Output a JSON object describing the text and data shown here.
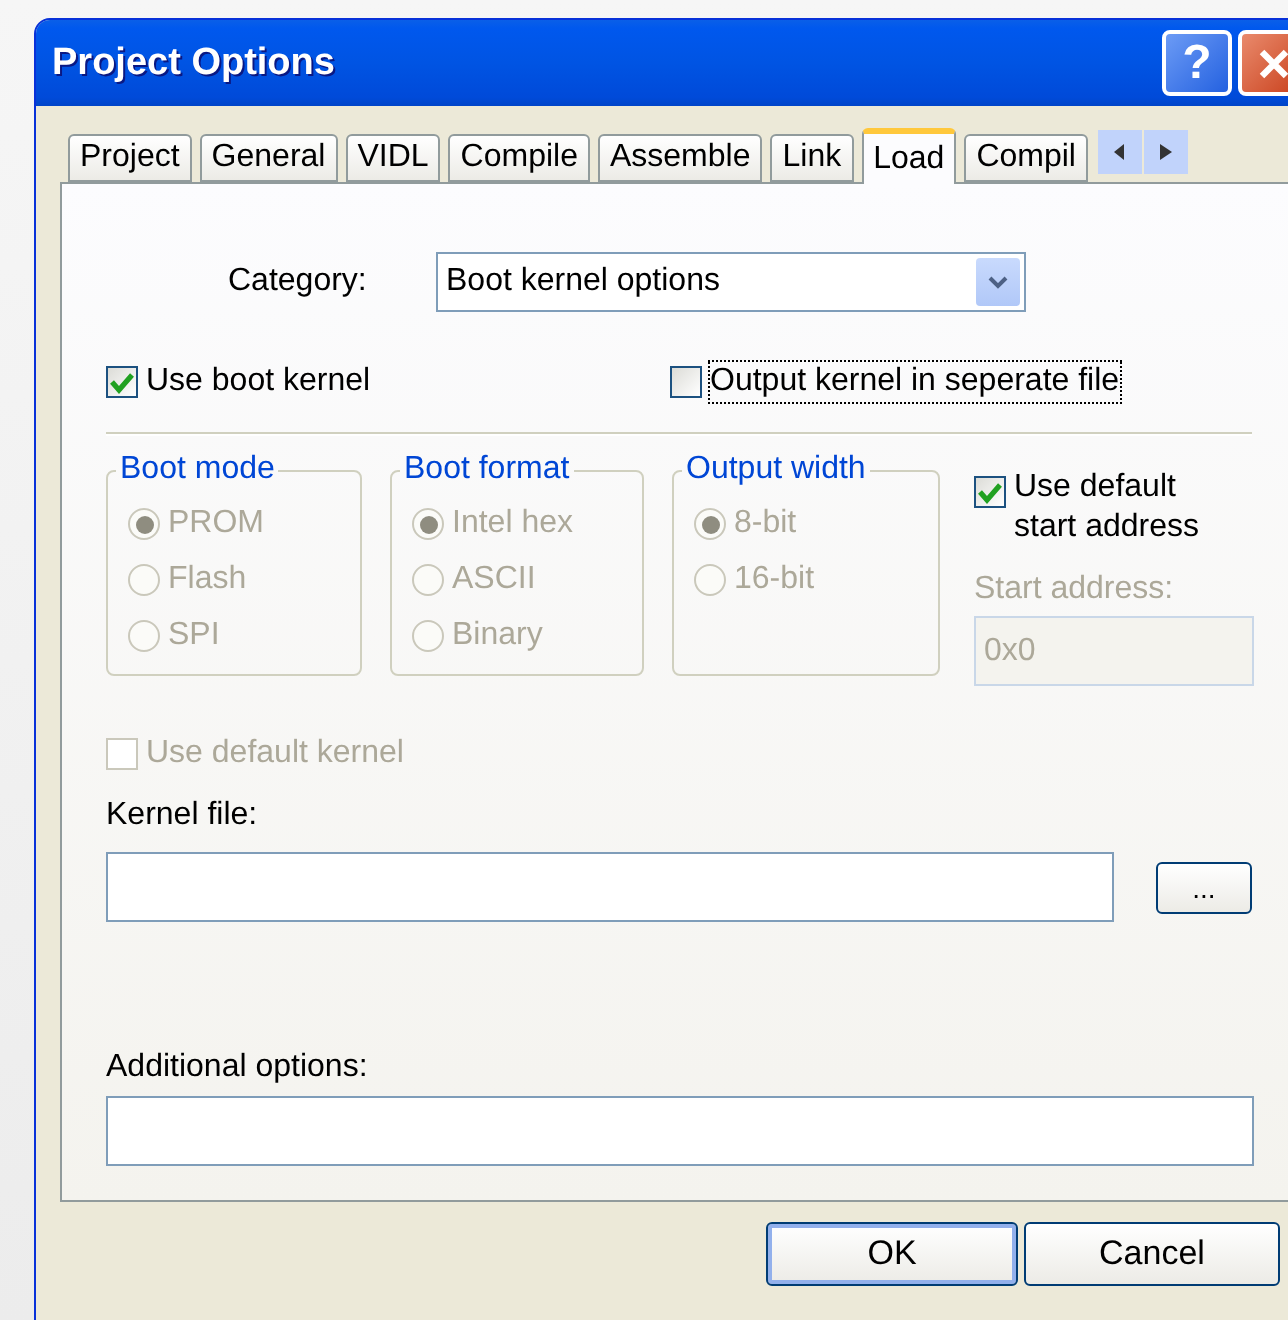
{
  "window": {
    "title": "Project Options",
    "help_button": "?"
  },
  "tabs": [
    {
      "label": "Project",
      "selected": false
    },
    {
      "label": "General",
      "selected": false
    },
    {
      "label": "VIDL",
      "selected": false
    },
    {
      "label": "Compile",
      "selected": false
    },
    {
      "label": "Assemble",
      "selected": false
    },
    {
      "label": "Link",
      "selected": false
    },
    {
      "label": "Load",
      "selected": true
    },
    {
      "label": "Compil",
      "selected": false
    }
  ],
  "category": {
    "label": "Category:",
    "value": "Boot kernel options"
  },
  "options": [
    {
      "label": "Use boot kernel",
      "checked": true,
      "focused": false
    },
    {
      "label": "Output kernel in seperate file",
      "checked": false,
      "focused": true
    }
  ],
  "groups": [
    {
      "title": "Boot mode",
      "disabled": true,
      "choices": [
        {
          "label": "PROM",
          "selected": true
        },
        {
          "label": "Flash",
          "selected": false
        },
        {
          "label": "SPI",
          "selected": false
        }
      ]
    },
    {
      "title": "Boot format",
      "disabled": true,
      "choices": [
        {
          "label": "Intel hex",
          "selected": true
        },
        {
          "label": "ASCII",
          "selected": false
        },
        {
          "label": "Binary",
          "selected": false
        }
      ]
    },
    {
      "title": "Output width",
      "disabled": true,
      "choices": [
        {
          "label": "8-bit",
          "selected": true
        },
        {
          "label": "16-bit",
          "selected": false
        }
      ]
    }
  ],
  "start_address": {
    "use_default": {
      "label": "Use default start address",
      "checked": true
    },
    "label": "Start address:",
    "value": "0x0",
    "disabled": true
  },
  "default_kernel": {
    "label": "Use default kernel",
    "checked": false,
    "disabled": true
  },
  "kernel_file": {
    "label": "Kernel file:",
    "browse_button": "..."
  },
  "additional_options": {
    "label": "Additional options:"
  },
  "buttons": [
    {
      "label": "OK",
      "default": true
    },
    {
      "label": "Cancel",
      "default": false
    }
  ]
}
